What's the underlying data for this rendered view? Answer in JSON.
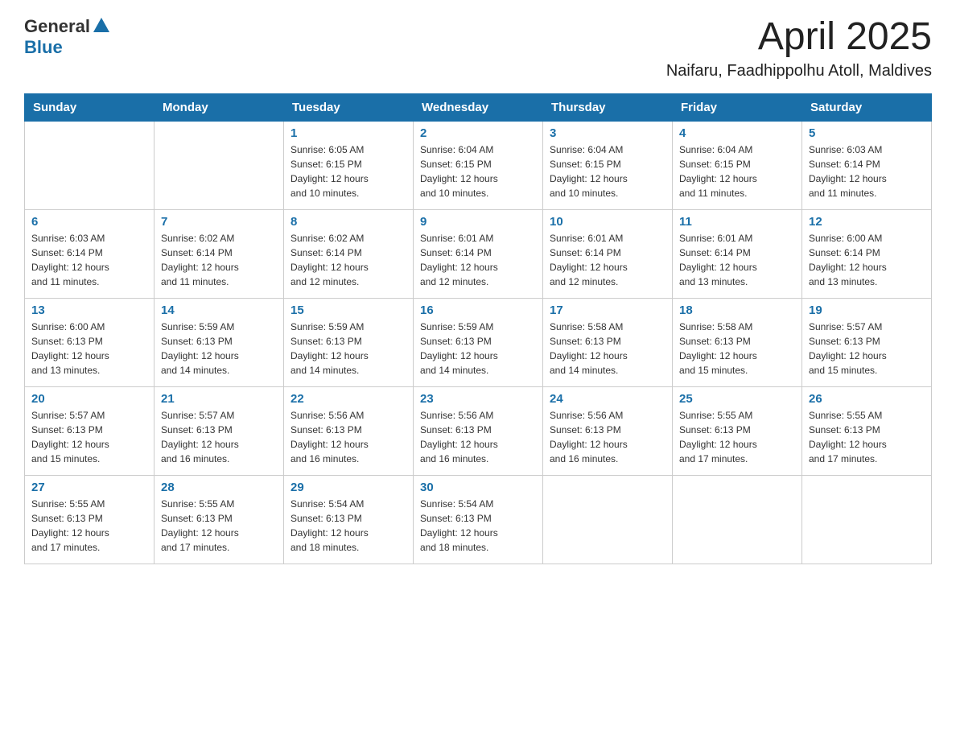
{
  "header": {
    "logo": {
      "general": "General",
      "blue": "Blue"
    },
    "title": "April 2025",
    "location": "Naifaru, Faadhippolhu Atoll, Maldives"
  },
  "calendar": {
    "weekdays": [
      "Sunday",
      "Monday",
      "Tuesday",
      "Wednesday",
      "Thursday",
      "Friday",
      "Saturday"
    ],
    "weeks": [
      [
        {
          "day": "",
          "info": ""
        },
        {
          "day": "",
          "info": ""
        },
        {
          "day": "1",
          "info": "Sunrise: 6:05 AM\nSunset: 6:15 PM\nDaylight: 12 hours\nand 10 minutes."
        },
        {
          "day": "2",
          "info": "Sunrise: 6:04 AM\nSunset: 6:15 PM\nDaylight: 12 hours\nand 10 minutes."
        },
        {
          "day": "3",
          "info": "Sunrise: 6:04 AM\nSunset: 6:15 PM\nDaylight: 12 hours\nand 10 minutes."
        },
        {
          "day": "4",
          "info": "Sunrise: 6:04 AM\nSunset: 6:15 PM\nDaylight: 12 hours\nand 11 minutes."
        },
        {
          "day": "5",
          "info": "Sunrise: 6:03 AM\nSunset: 6:14 PM\nDaylight: 12 hours\nand 11 minutes."
        }
      ],
      [
        {
          "day": "6",
          "info": "Sunrise: 6:03 AM\nSunset: 6:14 PM\nDaylight: 12 hours\nand 11 minutes."
        },
        {
          "day": "7",
          "info": "Sunrise: 6:02 AM\nSunset: 6:14 PM\nDaylight: 12 hours\nand 11 minutes."
        },
        {
          "day": "8",
          "info": "Sunrise: 6:02 AM\nSunset: 6:14 PM\nDaylight: 12 hours\nand 12 minutes."
        },
        {
          "day": "9",
          "info": "Sunrise: 6:01 AM\nSunset: 6:14 PM\nDaylight: 12 hours\nand 12 minutes."
        },
        {
          "day": "10",
          "info": "Sunrise: 6:01 AM\nSunset: 6:14 PM\nDaylight: 12 hours\nand 12 minutes."
        },
        {
          "day": "11",
          "info": "Sunrise: 6:01 AM\nSunset: 6:14 PM\nDaylight: 12 hours\nand 13 minutes."
        },
        {
          "day": "12",
          "info": "Sunrise: 6:00 AM\nSunset: 6:14 PM\nDaylight: 12 hours\nand 13 minutes."
        }
      ],
      [
        {
          "day": "13",
          "info": "Sunrise: 6:00 AM\nSunset: 6:13 PM\nDaylight: 12 hours\nand 13 minutes."
        },
        {
          "day": "14",
          "info": "Sunrise: 5:59 AM\nSunset: 6:13 PM\nDaylight: 12 hours\nand 14 minutes."
        },
        {
          "day": "15",
          "info": "Sunrise: 5:59 AM\nSunset: 6:13 PM\nDaylight: 12 hours\nand 14 minutes."
        },
        {
          "day": "16",
          "info": "Sunrise: 5:59 AM\nSunset: 6:13 PM\nDaylight: 12 hours\nand 14 minutes."
        },
        {
          "day": "17",
          "info": "Sunrise: 5:58 AM\nSunset: 6:13 PM\nDaylight: 12 hours\nand 14 minutes."
        },
        {
          "day": "18",
          "info": "Sunrise: 5:58 AM\nSunset: 6:13 PM\nDaylight: 12 hours\nand 15 minutes."
        },
        {
          "day": "19",
          "info": "Sunrise: 5:57 AM\nSunset: 6:13 PM\nDaylight: 12 hours\nand 15 minutes."
        }
      ],
      [
        {
          "day": "20",
          "info": "Sunrise: 5:57 AM\nSunset: 6:13 PM\nDaylight: 12 hours\nand 15 minutes."
        },
        {
          "day": "21",
          "info": "Sunrise: 5:57 AM\nSunset: 6:13 PM\nDaylight: 12 hours\nand 16 minutes."
        },
        {
          "day": "22",
          "info": "Sunrise: 5:56 AM\nSunset: 6:13 PM\nDaylight: 12 hours\nand 16 minutes."
        },
        {
          "day": "23",
          "info": "Sunrise: 5:56 AM\nSunset: 6:13 PM\nDaylight: 12 hours\nand 16 minutes."
        },
        {
          "day": "24",
          "info": "Sunrise: 5:56 AM\nSunset: 6:13 PM\nDaylight: 12 hours\nand 16 minutes."
        },
        {
          "day": "25",
          "info": "Sunrise: 5:55 AM\nSunset: 6:13 PM\nDaylight: 12 hours\nand 17 minutes."
        },
        {
          "day": "26",
          "info": "Sunrise: 5:55 AM\nSunset: 6:13 PM\nDaylight: 12 hours\nand 17 minutes."
        }
      ],
      [
        {
          "day": "27",
          "info": "Sunrise: 5:55 AM\nSunset: 6:13 PM\nDaylight: 12 hours\nand 17 minutes."
        },
        {
          "day": "28",
          "info": "Sunrise: 5:55 AM\nSunset: 6:13 PM\nDaylight: 12 hours\nand 17 minutes."
        },
        {
          "day": "29",
          "info": "Sunrise: 5:54 AM\nSunset: 6:13 PM\nDaylight: 12 hours\nand 18 minutes."
        },
        {
          "day": "30",
          "info": "Sunrise: 5:54 AM\nSunset: 6:13 PM\nDaylight: 12 hours\nand 18 minutes."
        },
        {
          "day": "",
          "info": ""
        },
        {
          "day": "",
          "info": ""
        },
        {
          "day": "",
          "info": ""
        }
      ]
    ]
  }
}
